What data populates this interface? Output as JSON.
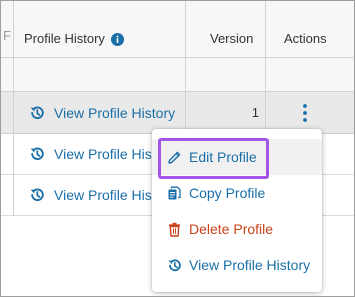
{
  "table": {
    "truncated_header_char": "F",
    "headers": {
      "profile_history": "Profile History",
      "version": "Version",
      "actions": "Actions"
    },
    "rows": [
      {
        "link": "View Profile History",
        "version": "1"
      },
      {
        "link": "View Profile Hist"
      },
      {
        "link": "View Profile Hist"
      }
    ]
  },
  "menu": {
    "items": [
      {
        "label": "Edit Profile",
        "icon": "pencil-icon"
      },
      {
        "label": "Copy Profile",
        "icon": "copy-icon"
      },
      {
        "label": "Delete Profile",
        "icon": "trash-icon"
      },
      {
        "label": "View Profile History",
        "icon": "history-icon"
      }
    ]
  },
  "colors": {
    "link": "#1a6fa8",
    "delete": "#c9421a",
    "highlight": "#a454e6",
    "selected_row": "#e9e9e9"
  }
}
